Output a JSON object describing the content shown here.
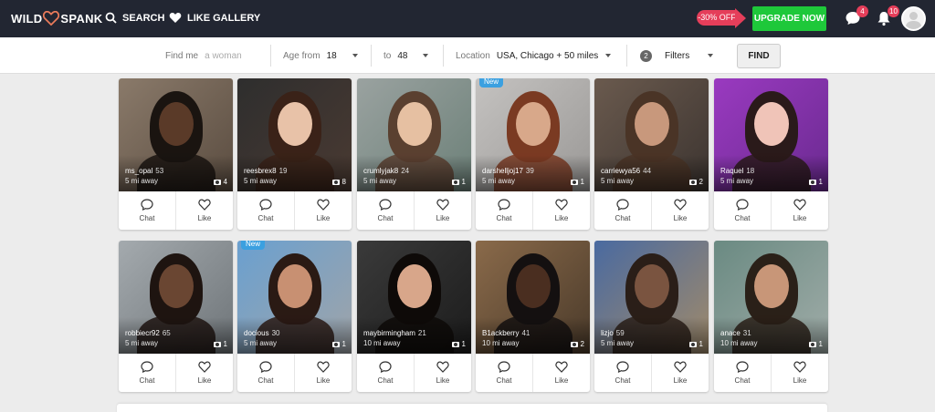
{
  "brand": {
    "left": "WILD",
    "right": "SPANK"
  },
  "nav": {
    "search": "SEARCH",
    "like_gallery": "LIKE GALLERY"
  },
  "promo": {
    "discount": "-30% OFF",
    "upgrade": "UPGRADE NOW"
  },
  "notifications": {
    "messages": "4",
    "alerts": "10"
  },
  "filters": {
    "find_me_label": "Find me",
    "find_me_placeholder": "a woman",
    "age_from_label": "Age from",
    "age_from": "18",
    "age_to_label": "to",
    "age_to": "48",
    "location_label": "Location",
    "location": "USA, Chicago + 50 miles",
    "filters_count": "2",
    "filters_label": "Filters",
    "find_button": "FIND"
  },
  "actions": {
    "chat": "Chat",
    "like": "Like"
  },
  "profiles": [
    {
      "name": "ms_opal",
      "age": "53",
      "distance": "5 mi away",
      "photos": "4",
      "new": false
    },
    {
      "name": "reesbrex8",
      "age": "19",
      "distance": "5 mi away",
      "photos": "8",
      "new": false
    },
    {
      "name": "crumlyjak8",
      "age": "24",
      "distance": "5 mi away",
      "photos": "1",
      "new": false
    },
    {
      "name": "darshelljoj17",
      "age": "39",
      "distance": "5 mi away",
      "photos": "1",
      "new": true
    },
    {
      "name": "carriewya56",
      "age": "44",
      "distance": "5 mi away",
      "photos": "2",
      "new": false
    },
    {
      "name": "Raquel",
      "age": "18",
      "distance": "5 mi away",
      "photos": "1",
      "new": false
    },
    {
      "name": "robbiecr92",
      "age": "65",
      "distance": "5 mi away",
      "photos": "1",
      "new": false
    },
    {
      "name": "docious",
      "age": "30",
      "distance": "5 mi away",
      "photos": "1",
      "new": true
    },
    {
      "name": "maybirmingham",
      "age": "21",
      "distance": "10 mi away",
      "photos": "1",
      "new": false
    },
    {
      "name": "B1ackberry",
      "age": "41",
      "distance": "10 mi away",
      "photos": "2",
      "new": false
    },
    {
      "name": "lizjo",
      "age": "59",
      "distance": "5 mi away",
      "photos": "1",
      "new": false
    },
    {
      "name": "anace",
      "age": "31",
      "distance": "10 mi away",
      "photos": "1",
      "new": false
    }
  ],
  "new_tag": "New",
  "colors": {
    "topbar": "#222632",
    "upgrade": "#1ec83a",
    "promo": "#e53e5a",
    "new_tag": "#3ba0e0"
  }
}
